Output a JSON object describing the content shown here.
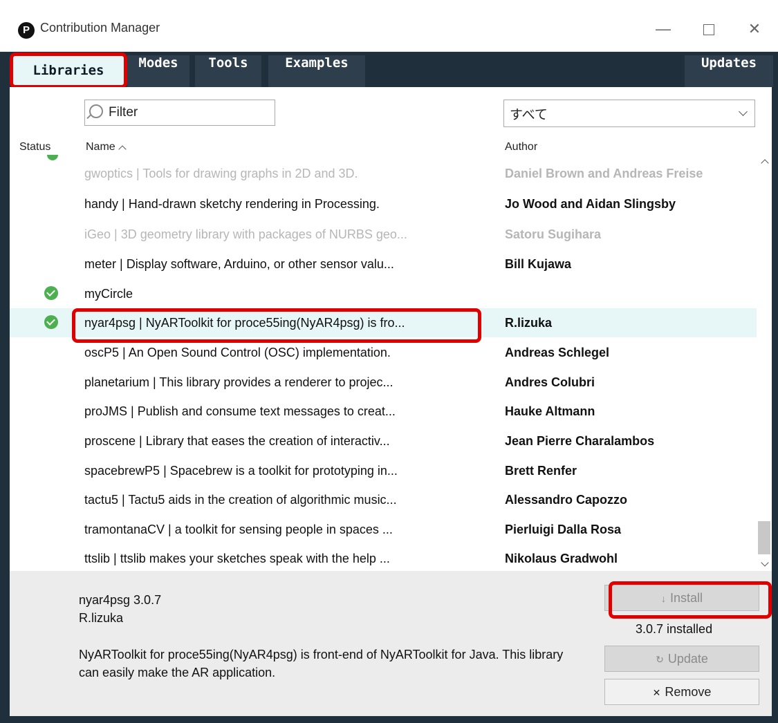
{
  "window": {
    "title": "Contribution Manager",
    "app_icon": "P",
    "minimize": "—",
    "close": "✕"
  },
  "tabs": [
    {
      "label": "Libraries",
      "active": true
    },
    {
      "label": "Modes"
    },
    {
      "label": "Tools"
    },
    {
      "label": "Examples"
    },
    {
      "label": "Updates"
    }
  ],
  "filter": {
    "placeholder": "Filter"
  },
  "category": {
    "selected": "すべて"
  },
  "columns": {
    "status": "Status",
    "name": "Name",
    "author": "Author"
  },
  "rows": [
    {
      "name": "gwoptics | Tools for drawing graphs in 2D and 3D.",
      "author": "Daniel Brown and Andreas Freise",
      "installed": false,
      "compatible": false
    },
    {
      "name": "handy | Hand-drawn sketchy rendering in Processing.",
      "author": "Jo Wood and Aidan Slingsby",
      "installed": false,
      "compatible": true
    },
    {
      "name": "iGeo | 3D geometry library with packages of NURBS geo...",
      "author": "Satoru Sugihara",
      "installed": false,
      "compatible": false
    },
    {
      "name": "meter | Display software, Arduino, or other sensor valu...",
      "author": "Bill  Kujawa",
      "installed": false,
      "compatible": true
    },
    {
      "name": "myCircle",
      "author": "",
      "installed": true,
      "compatible": true
    },
    {
      "name": "nyar4psg | NyARToolkit for proce55ing(NyAR4psg) is fro...",
      "author": "R.lizuka",
      "installed": true,
      "compatible": true,
      "selected": true
    },
    {
      "name": "oscP5 | An Open Sound Control (OSC) implementation.",
      "author": "Andreas Schlegel",
      "installed": false,
      "compatible": true
    },
    {
      "name": "planetarium | This library provides a renderer to projec...",
      "author": "Andres Colubri",
      "installed": false,
      "compatible": true
    },
    {
      "name": "proJMS | Publish and consume text messages to creat...",
      "author": "Hauke Altmann",
      "installed": false,
      "compatible": true
    },
    {
      "name": "proscene | Library that eases the creation of interactiv...",
      "author": "Jean Pierre Charalambos",
      "installed": false,
      "compatible": true
    },
    {
      "name": "spacebrewP5 | Spacebrew is a toolkit for prototyping in...",
      "author": "Brett Renfer",
      "installed": false,
      "compatible": true
    },
    {
      "name": "tactu5 | Tactu5 aids in the creation of algorithmic music...",
      "author": "Alessandro Capozzo",
      "installed": false,
      "compatible": true
    },
    {
      "name": "tramontanaCV | a toolkit for sensing people in spaces ...",
      "author": "Pierluigi Dalla Rosa",
      "installed": false,
      "compatible": true
    },
    {
      "name": "ttslib | ttslib makes your sketches speak with the help ...",
      "author": "Nikolaus Gradwohl",
      "installed": false,
      "compatible": true
    }
  ],
  "detail": {
    "title": "nyar4psg 3.0.7",
    "author": "R.lizuka",
    "description": "NyARToolkit for proce55ing(NyAR4psg) is front-end of NyARToolkit for Java. This library can easily make the AR application.",
    "install_label": "Install",
    "installed_version": "3.0.7 installed",
    "update_label": "Update",
    "remove_label": "Remove"
  },
  "icons": {
    "install": "download-arrow-icon",
    "update": "refresh-icon",
    "remove": "x-icon",
    "status": "check-circle-icon"
  },
  "colors": {
    "tab_bar": "#1f2f3b",
    "selected_row": "#e7f6f6",
    "installed_check": "#4caf50",
    "highlight": "#e00000"
  }
}
